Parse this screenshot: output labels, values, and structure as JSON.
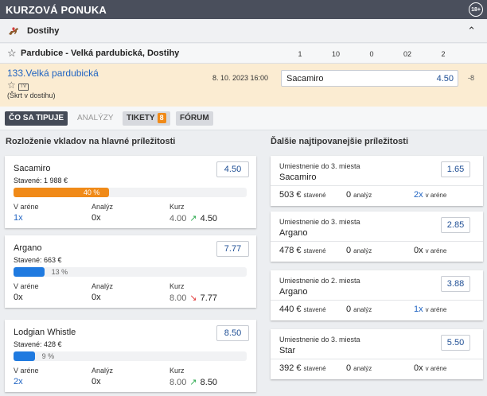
{
  "header": {
    "title": "KURZOVÁ PONUKA",
    "age_badge": "18+"
  },
  "sport": {
    "label": "Dostihy",
    "icon": "horse-icon",
    "chevron": "^"
  },
  "event": {
    "label": "Pardubice - Velká pardubická, Dostihy",
    "columns": [
      "1",
      "10",
      "0",
      "02",
      "2"
    ]
  },
  "match": {
    "name": "133.Velká pardubická",
    "sub": "(Škrt v dostihu)",
    "date": "8. 10. 2023  16:00",
    "selection": "Sacamiro",
    "odd": "4.50",
    "change": "-8",
    "tv_label": "TV"
  },
  "tabs": {
    "co_sa_tipuje": "ČO SA TIPUJE",
    "analyzy": "ANALÝZY",
    "tikety": "TIKETY",
    "tikety_count": "8",
    "forum": "FÓRUM"
  },
  "left": {
    "title": "Rozloženie vkladov na hlavné príležitosti",
    "labels": {
      "v_arene": "V aréne",
      "analyz": "Analýz",
      "kurz": "Kurz"
    },
    "cards": [
      {
        "name": "Sacamiro",
        "staked": "Stavené: 1 988 €",
        "odd": "4.50",
        "pct_label": "40 %",
        "pct": 40,
        "bar_color": "#f08a18",
        "v_arene": "1x",
        "analyz": "0x",
        "kurz_old": "4.00",
        "kurz_arrow": "↗",
        "kurz_new": "4.50",
        "direction": "up"
      },
      {
        "name": "Argano",
        "staked": "Stavené: 663 €",
        "odd": "7.77",
        "pct_label": "13 %",
        "pct": 13,
        "bar_color": "#1f7ae0",
        "v_arene": "0x",
        "analyz": "0x",
        "kurz_old": "8.00",
        "kurz_arrow": "↘",
        "kurz_new": "7.77",
        "direction": "down"
      },
      {
        "name": "Lodgian Whistle",
        "staked": "Stavené: 428 €",
        "odd": "8.50",
        "pct_label": "9 %",
        "pct": 9,
        "bar_color": "#1f7ae0",
        "v_arene": "2x",
        "analyz": "0x",
        "kurz_old": "8.00",
        "kurz_arrow": "↗",
        "kurz_new": "8.50",
        "direction": "up"
      }
    ]
  },
  "right": {
    "title": "Ďalšie najtipovanejšie príležitosti",
    "labels": {
      "stavene": "stavené",
      "analyz": "analýz",
      "v_arene": "v aréne"
    },
    "cards": [
      {
        "type": "Umiestnenie do 3. miesta",
        "name": "Sacamiro",
        "odd": "1.65",
        "staked": "503 €",
        "analyz": "0",
        "arena": "2x"
      },
      {
        "type": "Umiestnenie do 3. miesta",
        "name": "Argano",
        "odd": "2.85",
        "staked": "478 €",
        "analyz": "0",
        "arena": "0x"
      },
      {
        "type": "Umiestnenie do 2. miesta",
        "name": "Argano",
        "odd": "3.88",
        "staked": "440 €",
        "analyz": "0",
        "arena": "1x"
      },
      {
        "type": "Umiestnenie do 3. miesta",
        "name": "Star",
        "odd": "5.50",
        "staked": "392 €",
        "analyz": "0",
        "arena": "0x"
      }
    ]
  }
}
